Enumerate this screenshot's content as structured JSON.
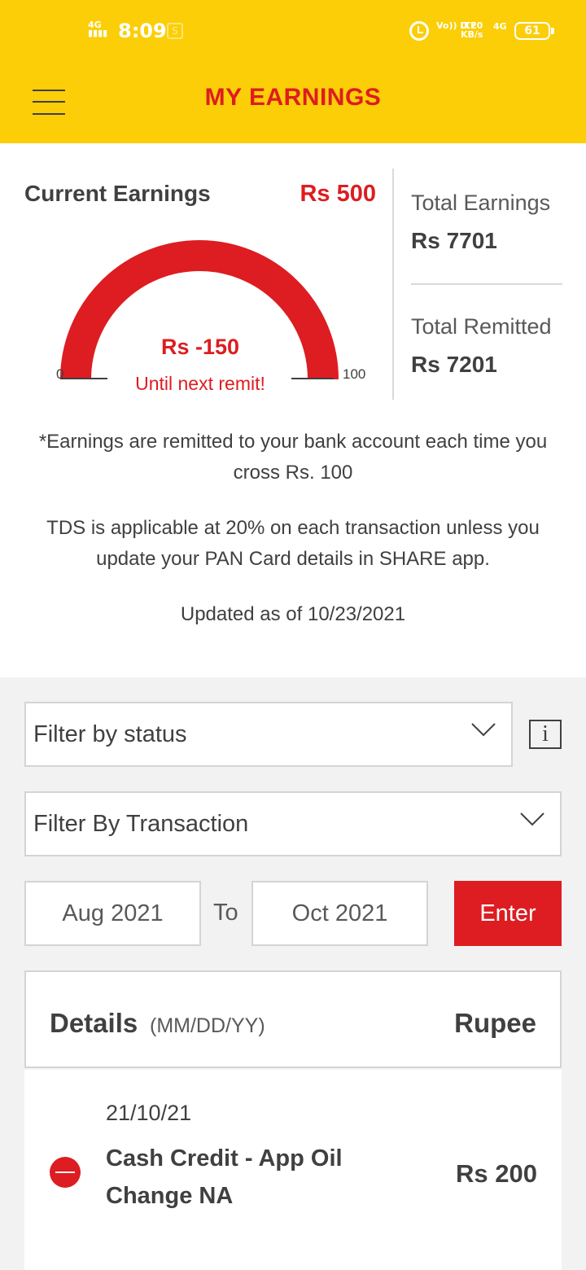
{
  "status_bar": {
    "network": "4G",
    "time": "8:09",
    "volte": "Vo)) LTE",
    "speed_value": "0.20",
    "speed_unit": "KB/s",
    "signal_type": "4G",
    "battery": "61"
  },
  "header": {
    "title": "MY EARNINGS",
    "menu_icon": "hamburger-menu-icon"
  },
  "summary": {
    "current_label": "Current Earnings",
    "current_value": "Rs 500",
    "gauge": {
      "value_text": "Rs -150",
      "subtext": "Until next remit!",
      "min": "0",
      "max": "100",
      "fill_fraction": 1.0
    },
    "total_earnings_label": "Total Earnings",
    "total_earnings_value": "Rs 7701",
    "total_remitted_label": "Total Remitted",
    "total_remitted_value": "Rs 7201",
    "note1": "*Earnings are remitted to your bank account each time you cross Rs. 100",
    "note2": "TDS is applicable at 20% on each transaction unless you update your PAN Card details in SHARE app.",
    "updated": "Updated as of 10/23/2021"
  },
  "filters": {
    "status_placeholder": "Filter by status",
    "transaction_placeholder": "Filter By Transaction",
    "info_icon": "i",
    "date_from": "Aug 2021",
    "to_label": "To",
    "date_to": "Oct 2021",
    "enter_label": "Enter"
  },
  "table": {
    "details_label": "Details",
    "date_format": "(MM/DD/YY)",
    "amount_label": "Rupee",
    "rows": [
      {
        "date": "21/10/21",
        "description": "Cash Credit - App Oil Change NA",
        "amount": "Rs 200",
        "icon": "minus-circle-icon"
      }
    ]
  },
  "colors": {
    "brand_yellow": "#fbce07",
    "brand_red": "#dd1d21",
    "text_dark": "#404040"
  }
}
